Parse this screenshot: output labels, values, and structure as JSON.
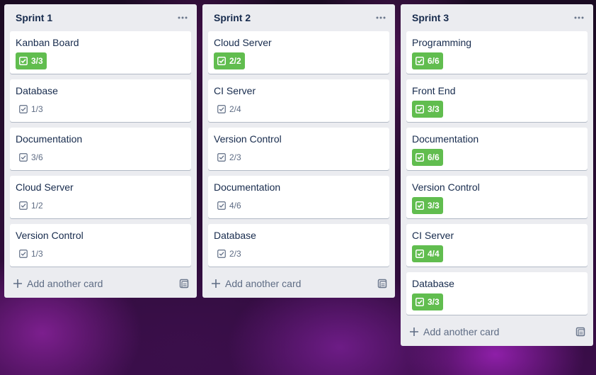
{
  "lists": [
    {
      "title": "Sprint 1",
      "cards": [
        {
          "title": "Kanban Board",
          "checklist": "3/3",
          "complete": true
        },
        {
          "title": "Database",
          "checklist": "1/3",
          "complete": false
        },
        {
          "title": "Documentation",
          "checklist": "3/6",
          "complete": false
        },
        {
          "title": "Cloud Server",
          "checklist": "1/2",
          "complete": false
        },
        {
          "title": "Version Control",
          "checklist": "1/3",
          "complete": false
        }
      ],
      "add_label": "Add another card"
    },
    {
      "title": "Sprint 2",
      "cards": [
        {
          "title": "Cloud Server",
          "checklist": "2/2",
          "complete": true
        },
        {
          "title": "CI Server",
          "checklist": "2/4",
          "complete": false
        },
        {
          "title": "Version Control",
          "checklist": "2/3",
          "complete": false
        },
        {
          "title": "Documentation",
          "checklist": "4/6",
          "complete": false
        },
        {
          "title": "Database",
          "checklist": "2/3",
          "complete": false
        }
      ],
      "add_label": "Add another card"
    },
    {
      "title": "Sprint 3",
      "cards": [
        {
          "title": "Programming",
          "checklist": "6/6",
          "complete": true
        },
        {
          "title": "Front End",
          "checklist": "3/3",
          "complete": true
        },
        {
          "title": "Documentation",
          "checklist": "6/6",
          "complete": true
        },
        {
          "title": "Version Control",
          "checklist": "3/3",
          "complete": true
        },
        {
          "title": "CI Server",
          "checklist": "4/4",
          "complete": true
        },
        {
          "title": "Database",
          "checklist": "3/3",
          "complete": true
        }
      ],
      "add_label": "Add another card"
    }
  ],
  "icons": {
    "list_menu": "more-horizontal-icon",
    "checklist": "checklist-icon",
    "add": "plus-icon",
    "template": "card-template-icon"
  },
  "colors": {
    "complete_badge": "#61bd4f",
    "list_bg": "#ebecf0",
    "text": "#172b4d",
    "muted": "#5e6c84"
  }
}
